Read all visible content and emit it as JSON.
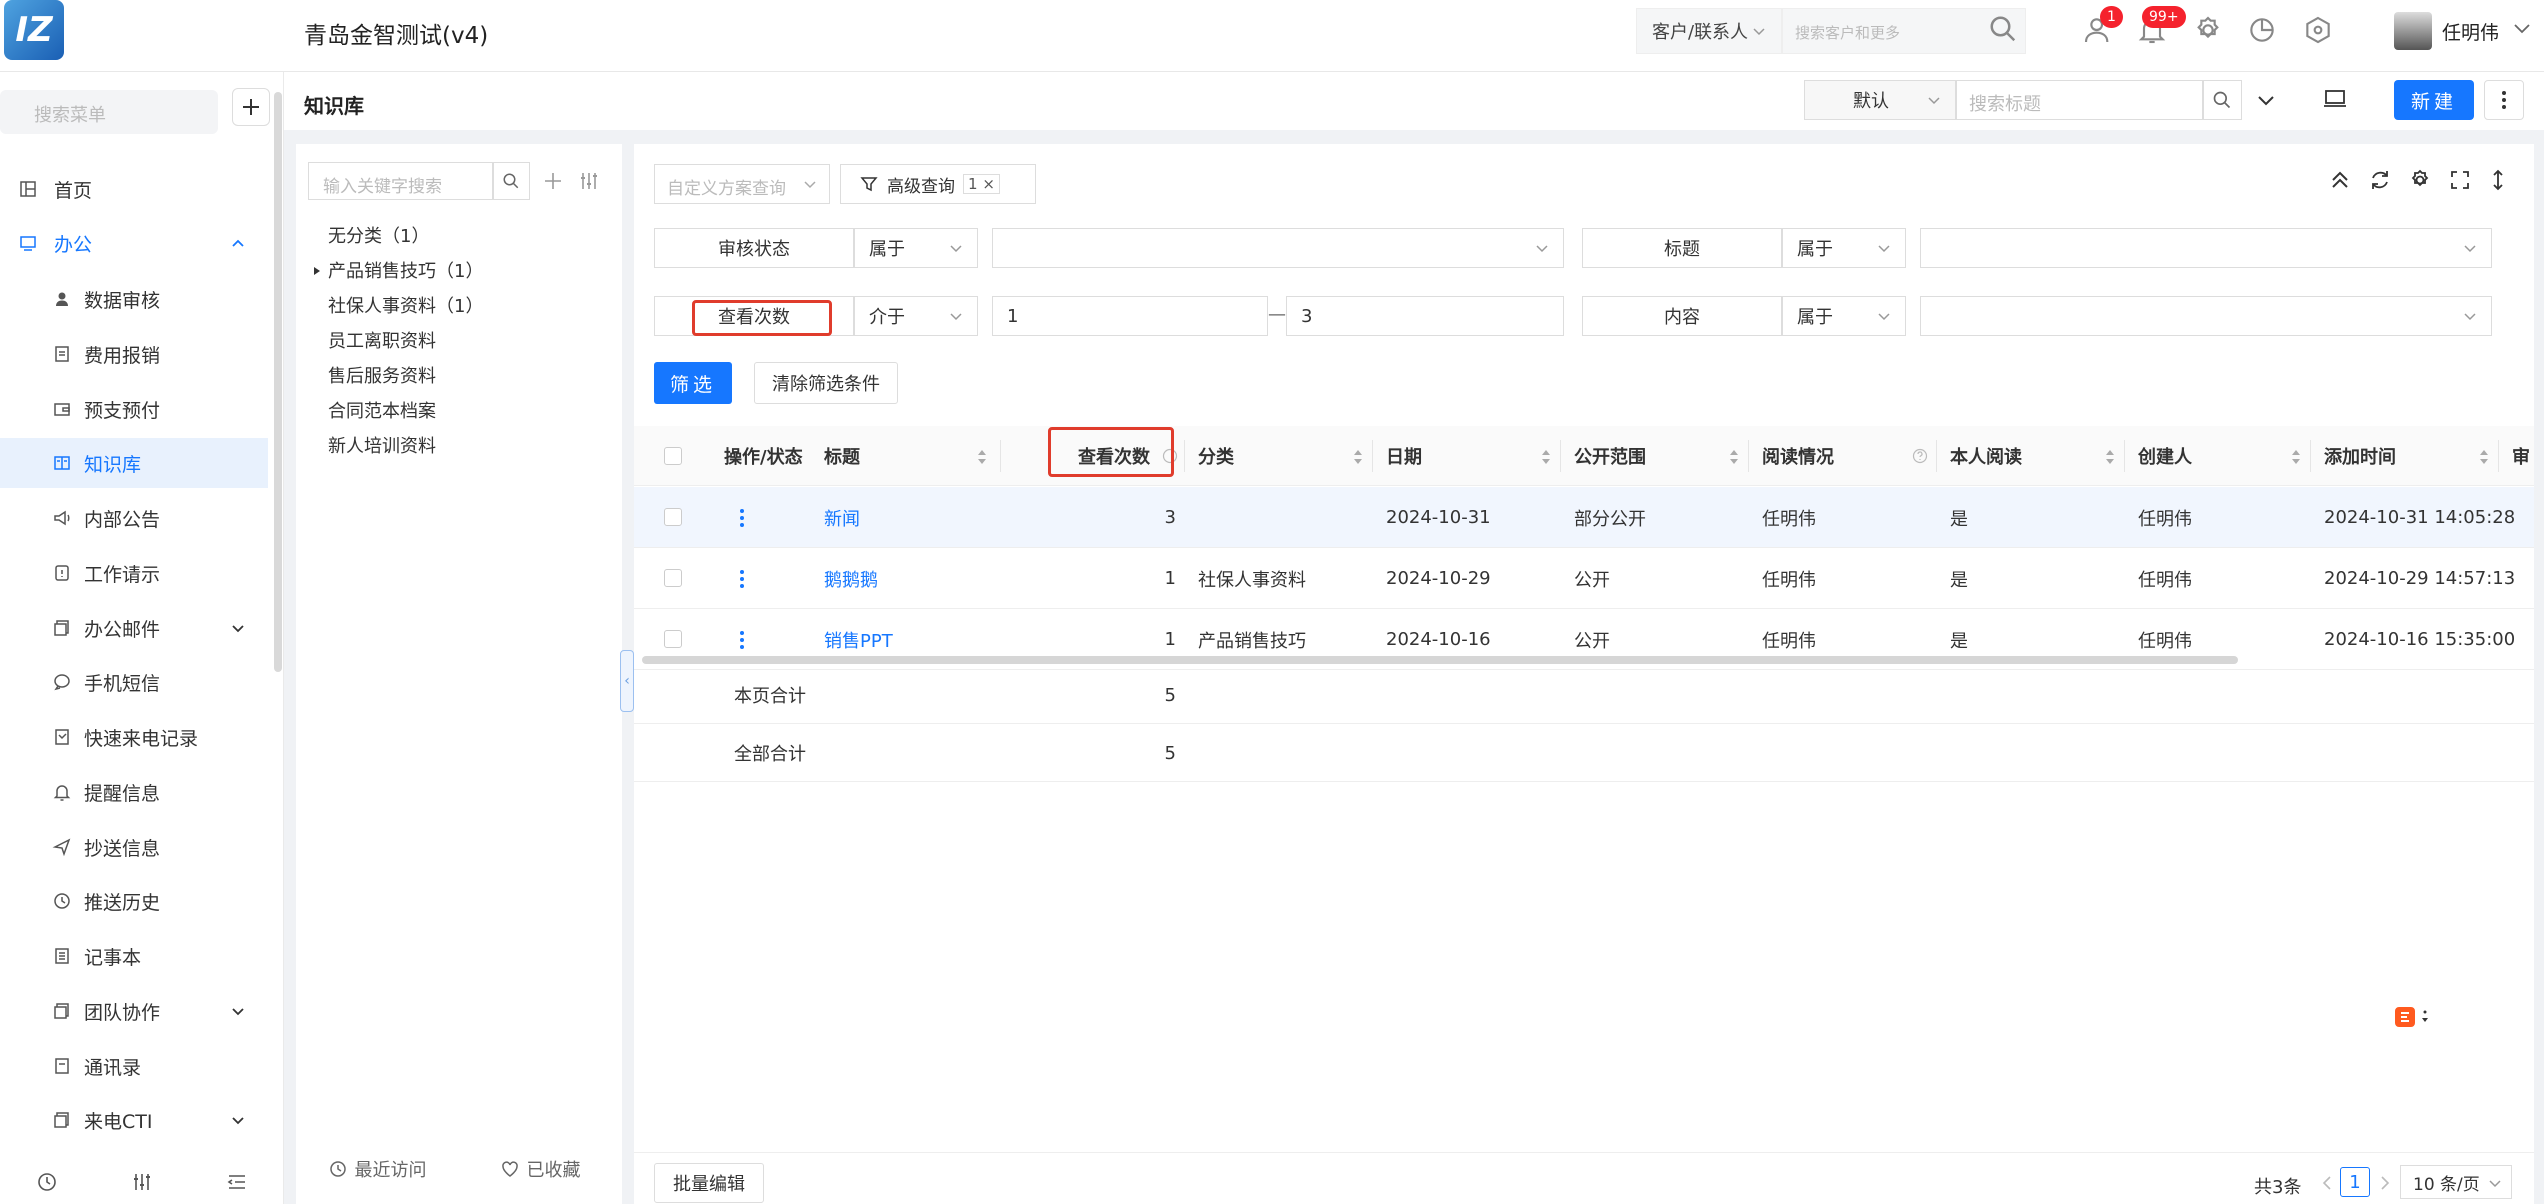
{
  "app": {
    "logo": "IZ",
    "title": "青岛金智测试(v4)",
    "customer_select": "客户/联系人",
    "customer_search_placeholder": "搜索客户和更多",
    "badge_tasks": "1",
    "badge_notifications": "99+",
    "user_name": "任明伟"
  },
  "sidebar": {
    "search_placeholder": "搜索菜单",
    "items": [
      {
        "label": "首页",
        "icon": "home-icon"
      },
      {
        "label": "办公",
        "icon": "office-icon"
      },
      {
        "label": "数据审核",
        "icon": "user-check-icon"
      },
      {
        "label": "费用报销",
        "icon": "receipt-icon"
      },
      {
        "label": "预支预付",
        "icon": "wallet-icon"
      },
      {
        "label": "知识库",
        "icon": "book-icon"
      },
      {
        "label": "内部公告",
        "icon": "announcement-icon"
      },
      {
        "label": "工作请示",
        "icon": "request-icon"
      },
      {
        "label": "办公邮件",
        "icon": "mail-icon"
      },
      {
        "label": "手机短信",
        "icon": "sms-icon"
      },
      {
        "label": "快速来电记录",
        "icon": "call-log-icon"
      },
      {
        "label": "提醒信息",
        "icon": "bell-icon"
      },
      {
        "label": "抄送信息",
        "icon": "send-icon"
      },
      {
        "label": "推送历史",
        "icon": "history-icon"
      },
      {
        "label": "记事本",
        "icon": "notebook-icon"
      },
      {
        "label": "团队协作",
        "icon": "team-icon"
      },
      {
        "label": "通讯录",
        "icon": "contacts-icon"
      },
      {
        "label": "来电CTI",
        "icon": "cti-icon"
      }
    ]
  },
  "page": {
    "title": "知识库",
    "view_select": "默认",
    "title_search_placeholder": "搜索标题",
    "new_button": "新建"
  },
  "categories": {
    "search_placeholder": "输入关键字搜索",
    "items": [
      "无分类（1）",
      "产品销售技巧（1）",
      "社保人事资料（1）",
      "员工离职资料",
      "售后服务资料",
      "合同范本档案",
      "新人培训资料"
    ],
    "recent_label": "最近访问",
    "favorites_label": "已收藏"
  },
  "filters": {
    "scheme_placeholder": "自定义方案查询",
    "advanced_label": "高级查询",
    "advanced_count": "1",
    "row1": {
      "label1": "审核状态",
      "op1": "属于",
      "val1": "",
      "label2": "标题",
      "op2": "属于",
      "val2": ""
    },
    "row2": {
      "label1": "查看次数",
      "op1": "介于",
      "from": "1",
      "to": "3",
      "label2": "内容",
      "op2": "属于",
      "val2": ""
    },
    "sep": "—",
    "filter_button": "筛选",
    "clear_button": "清除筛选条件"
  },
  "table": {
    "columns": [
      "操作/状态",
      "标题",
      "查看次数",
      "分类",
      "日期",
      "公开范围",
      "阅读情况",
      "本人阅读",
      "创建人",
      "添加时间",
      "审"
    ],
    "rows": [
      {
        "title": "新闻",
        "views": "3",
        "category": "",
        "date": "2024-10-31",
        "scope": "部分公开",
        "read_status": "任明伟",
        "self_read": "是",
        "creator": "任明伟",
        "added": "2024-10-31 14:05:28"
      },
      {
        "title": "鹅鹅鹅",
        "views": "1",
        "category": "社保人事资料",
        "date": "2024-10-29",
        "scope": "公开",
        "read_status": "任明伟",
        "self_read": "是",
        "creator": "任明伟",
        "added": "2024-10-29 14:57:13"
      },
      {
        "title": "销售PPT",
        "views": "1",
        "category": "产品销售技巧",
        "date": "2024-10-16",
        "scope": "公开",
        "read_status": "任明伟",
        "self_read": "是",
        "creator": "任明伟",
        "added": "2024-10-16 15:35:00"
      }
    ],
    "page_total_label": "本页合计",
    "page_total_value": "5",
    "all_total_label": "全部合计",
    "all_total_value": "5"
  },
  "footer": {
    "batch_edit": "批量编辑",
    "total": "共3条",
    "current_page": "1",
    "page_size": "10 条/页"
  },
  "colors": {
    "primary": "#1677ff",
    "highlight_box": "#e03c2c",
    "badge": "#f5222d"
  }
}
